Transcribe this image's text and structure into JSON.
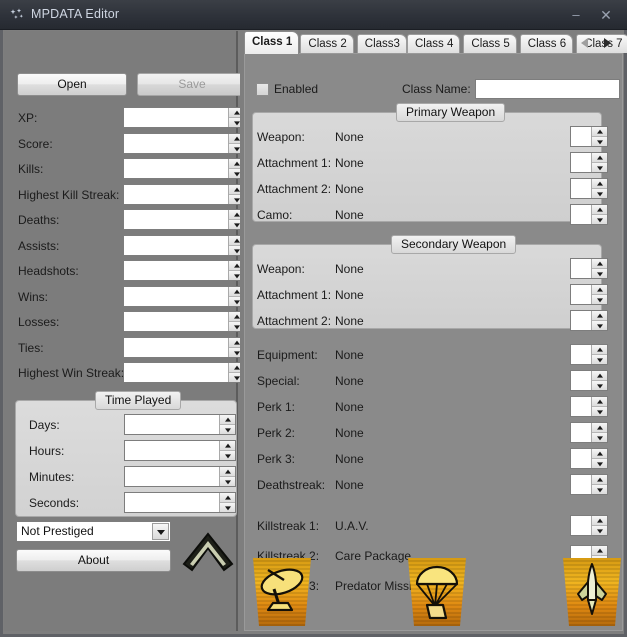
{
  "window": {
    "title": "MPDATA Editor",
    "icon": "sparkle-icon",
    "minimize_label": "–",
    "close_label": "✕"
  },
  "left_panel": {
    "open_label": "Open",
    "save_label": "Save",
    "save_disabled": true,
    "stats": [
      {
        "label": "XP:",
        "value": ""
      },
      {
        "label": "Score:",
        "value": ""
      },
      {
        "label": "Kills:",
        "value": ""
      },
      {
        "label": "Highest Kill Streak:",
        "value": ""
      },
      {
        "label": "Deaths:",
        "value": ""
      },
      {
        "label": "Assists:",
        "value": ""
      },
      {
        "label": "Headshots:",
        "value": ""
      },
      {
        "label": "Wins:",
        "value": ""
      },
      {
        "label": "Losses:",
        "value": ""
      },
      {
        "label": "Ties:",
        "value": ""
      },
      {
        "label": "Highest Win Streak:",
        "value": ""
      }
    ],
    "time_played": {
      "title": "Time Played",
      "fields": [
        {
          "label": "Days:",
          "value": ""
        },
        {
          "label": "Hours:",
          "value": ""
        },
        {
          "label": "Minutes:",
          "value": ""
        },
        {
          "label": "Seconds:",
          "value": ""
        }
      ]
    },
    "prestige": {
      "selected": "Not Prestiged"
    },
    "about_label": "About",
    "rank_emblem": "chevron-rank-icon"
  },
  "right_panel": {
    "tabs": [
      {
        "label": "Class 1",
        "active": true
      },
      {
        "label": "Class 2",
        "active": false
      },
      {
        "label": "Class3",
        "active": false
      },
      {
        "label": "Class 4",
        "active": false
      },
      {
        "label": "Class 5",
        "active": false
      },
      {
        "label": "Class 6",
        "active": false
      },
      {
        "label": "Class 7",
        "active": false
      }
    ],
    "tab_nav": {
      "prev": "chevron-left-icon",
      "next": "chevron-right-icon"
    },
    "enabled_label": "Enabled",
    "enabled_checked": false,
    "class_name_label": "Class Name:",
    "class_name_value": "",
    "primary": {
      "title": "Primary Weapon",
      "rows": [
        {
          "label": "Weapon:",
          "value": "None",
          "spin": ""
        },
        {
          "label": "Attachment 1:",
          "value": "None",
          "spin": ""
        },
        {
          "label": "Attachment 2:",
          "value": "None",
          "spin": ""
        },
        {
          "label": "Camo:",
          "value": "None",
          "spin": ""
        }
      ]
    },
    "secondary": {
      "title": "Secondary Weapon",
      "rows": [
        {
          "label": "Weapon:",
          "value": "None",
          "spin": ""
        },
        {
          "label": "Attachment 1:",
          "value": "None",
          "spin": ""
        },
        {
          "label": "Attachment 2:",
          "value": "None",
          "spin": ""
        }
      ]
    },
    "loadout": [
      {
        "label": "Equipment:",
        "value": "None",
        "spin": ""
      },
      {
        "label": "Special:",
        "value": "None",
        "spin": ""
      },
      {
        "label": "Perk 1:",
        "value": "None",
        "spin": ""
      },
      {
        "label": "Perk 2:",
        "value": "None",
        "spin": ""
      },
      {
        "label": "Perk 3:",
        "value": "None",
        "spin": ""
      },
      {
        "label": "Deathstreak:",
        "value": "None",
        "spin": ""
      }
    ],
    "killstreaks": [
      {
        "label": "Killstreak 1:",
        "value": "U.A.V.",
        "spin": "",
        "icon": "radar-dish-icon"
      },
      {
        "label": "Killstreak 2:",
        "value": "Care Package",
        "spin": "",
        "icon": "parachute-crate-icon"
      },
      {
        "label": "Killstreak 3:",
        "value": "Predator Missile",
        "spin": "",
        "icon": "missile-icon"
      }
    ]
  },
  "colors": {
    "window_bg": "#7e7e7e",
    "titlebar": "#2e323a",
    "title_text": "#cfd6e2",
    "group_bg": "#d4d4d4",
    "tabpage_bg": "#8a8a8a",
    "badge_gold": "#e8a21a"
  }
}
